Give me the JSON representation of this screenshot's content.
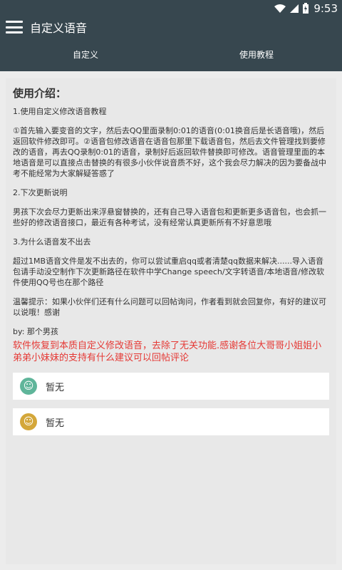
{
  "status_bar": {
    "time": "9:53"
  },
  "app_bar": {
    "title": "自定义语音"
  },
  "tabs": [
    {
      "label": "自定义"
    },
    {
      "label": "使用教程"
    }
  ],
  "content": {
    "title": "使用介绍：",
    "section1_title": "1.使用自定义修改语音教程",
    "section1_body": "①首先输入要变音的文字，然后去QQ里面录制0:01的语音(0:01换音后是长语音哦)，然后返回软件修改即可。②语音包修改语音在语音包那里下载语音包，然后去文件管理找到要修改的语音，再去QQ录制0:01的语音，录制好后返回软件替换即可修改。语音管理里面的本地语音是可以直接点击替换的有很多小伙伴说音质不好，这个我会尽力解决的因为要备战中考不能经常为大家解疑答惑了",
    "section2_title": "2.下次更新说明",
    "section2_body": "男孩下次会尽力更新出来浮悬窗替换的，还有自己导入语音包和更新更多语音包，也会抓一些好的修改语音接口，最近有各种考试，没有经常认真更新所有不好意思哦",
    "section3_title": "3.为什么语音发不出去",
    "section3_body": "超过1MB语音文件是发不出去的，你可以尝试重启qq或者清楚qq数据来解决......导入语音包请手动没空制作下次更新路径在软件中学Change speech/文字转语音/本地语音/修改软件使用QQ号也在那个路径",
    "tip": "温馨提示：如果小伙伴们还有什么问题可以回帖询问，作者看到就会回复你，有好的建议可以说哦！感谢",
    "by": "by: 那个男孩",
    "notice": "软件恢复到本质自定义修改语音，去除了无关功能.感谢各位大哥哥小姐姐小弟弟小妹妹的支持有什么建议可以回帖评论"
  },
  "items": [
    {
      "label": "暂无",
      "avatar_color": "#5fb59a",
      "icon": "smile-face-icon"
    },
    {
      "label": "暂无",
      "avatar_color": "#d4a73a",
      "icon": "smile-face-icon"
    }
  ],
  "colors": {
    "primary": "#37474f",
    "notice": "#e53935"
  }
}
